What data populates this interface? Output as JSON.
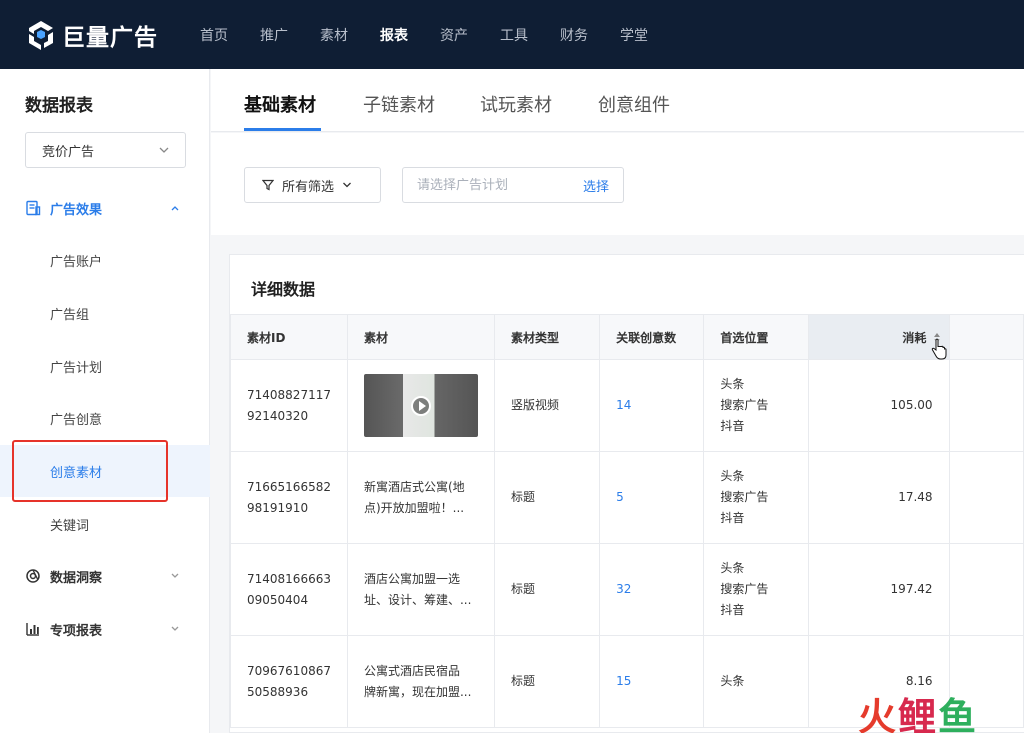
{
  "brand": {
    "name": "巨量广告"
  },
  "nav": [
    {
      "label": "首页",
      "active": false
    },
    {
      "label": "推广",
      "active": false
    },
    {
      "label": "素材",
      "active": false
    },
    {
      "label": "报表",
      "active": true
    },
    {
      "label": "资产",
      "active": false
    },
    {
      "label": "工具",
      "active": false
    },
    {
      "label": "财务",
      "active": false
    },
    {
      "label": "学堂",
      "active": false
    }
  ],
  "sidebar": {
    "title": "数据报表",
    "select_value": "竞价广告",
    "group_ad": "广告效果",
    "items": [
      "广告账户",
      "广告组",
      "广告计划",
      "广告创意",
      "创意素材",
      "关键词"
    ],
    "active_item": "创意素材",
    "group_insight": "数据洞察",
    "group_special": "专项报表"
  },
  "tabs": [
    {
      "label": "基础素材",
      "active": true
    },
    {
      "label": "子链素材",
      "active": false
    },
    {
      "label": "试玩素材",
      "active": false
    },
    {
      "label": "创意组件",
      "active": false
    }
  ],
  "filter": {
    "all_filters": "所有筛选",
    "plan_placeholder": "请选择广告计划",
    "plan_select": "选择"
  },
  "detail": {
    "title": "详细数据",
    "columns": [
      "素材ID",
      "素材",
      "素材类型",
      "关联创意数",
      "首选位置",
      "消耗"
    ],
    "rows": [
      {
        "id": "7140882711792140320",
        "id_l1": "71408827117",
        "id_l2": "92140320",
        "material_l1": "",
        "material_l2": "",
        "type": "竖版视频",
        "creatives": "14",
        "pos": [
          "头条",
          "搜索广告",
          "抖音"
        ],
        "cost": "105.00"
      },
      {
        "id": "7166516658298191910",
        "id_l1": "71665166582",
        "id_l2": "98191910",
        "material_l1": "新寓酒店式公寓(地",
        "material_l2": "点)开放加盟啦！...",
        "type": "标题",
        "creatives": "5",
        "pos": [
          "头条",
          "搜索广告",
          "抖音"
        ],
        "cost": "17.48"
      },
      {
        "id": "7140816666309050404",
        "id_l1": "71408166663",
        "id_l2": "09050404",
        "material_l1": "酒店公寓加盟一选",
        "material_l2": "址、设计、筹建、...",
        "type": "标题",
        "creatives": "32",
        "pos": [
          "头条",
          "搜索广告",
          "抖音"
        ],
        "cost": "197.42"
      },
      {
        "id": "7096761086750588936",
        "id_l1": "70967610867",
        "id_l2": "50588936",
        "material_l1": "公寓式酒店民宿品",
        "material_l2": "牌新寓，现在加盟...",
        "type": "标题",
        "creatives": "15",
        "pos": [
          "头条"
        ],
        "cost": "8.16"
      }
    ]
  },
  "watermark": {
    "c1": "火",
    "c2": "鲤",
    "c3": "鱼"
  }
}
